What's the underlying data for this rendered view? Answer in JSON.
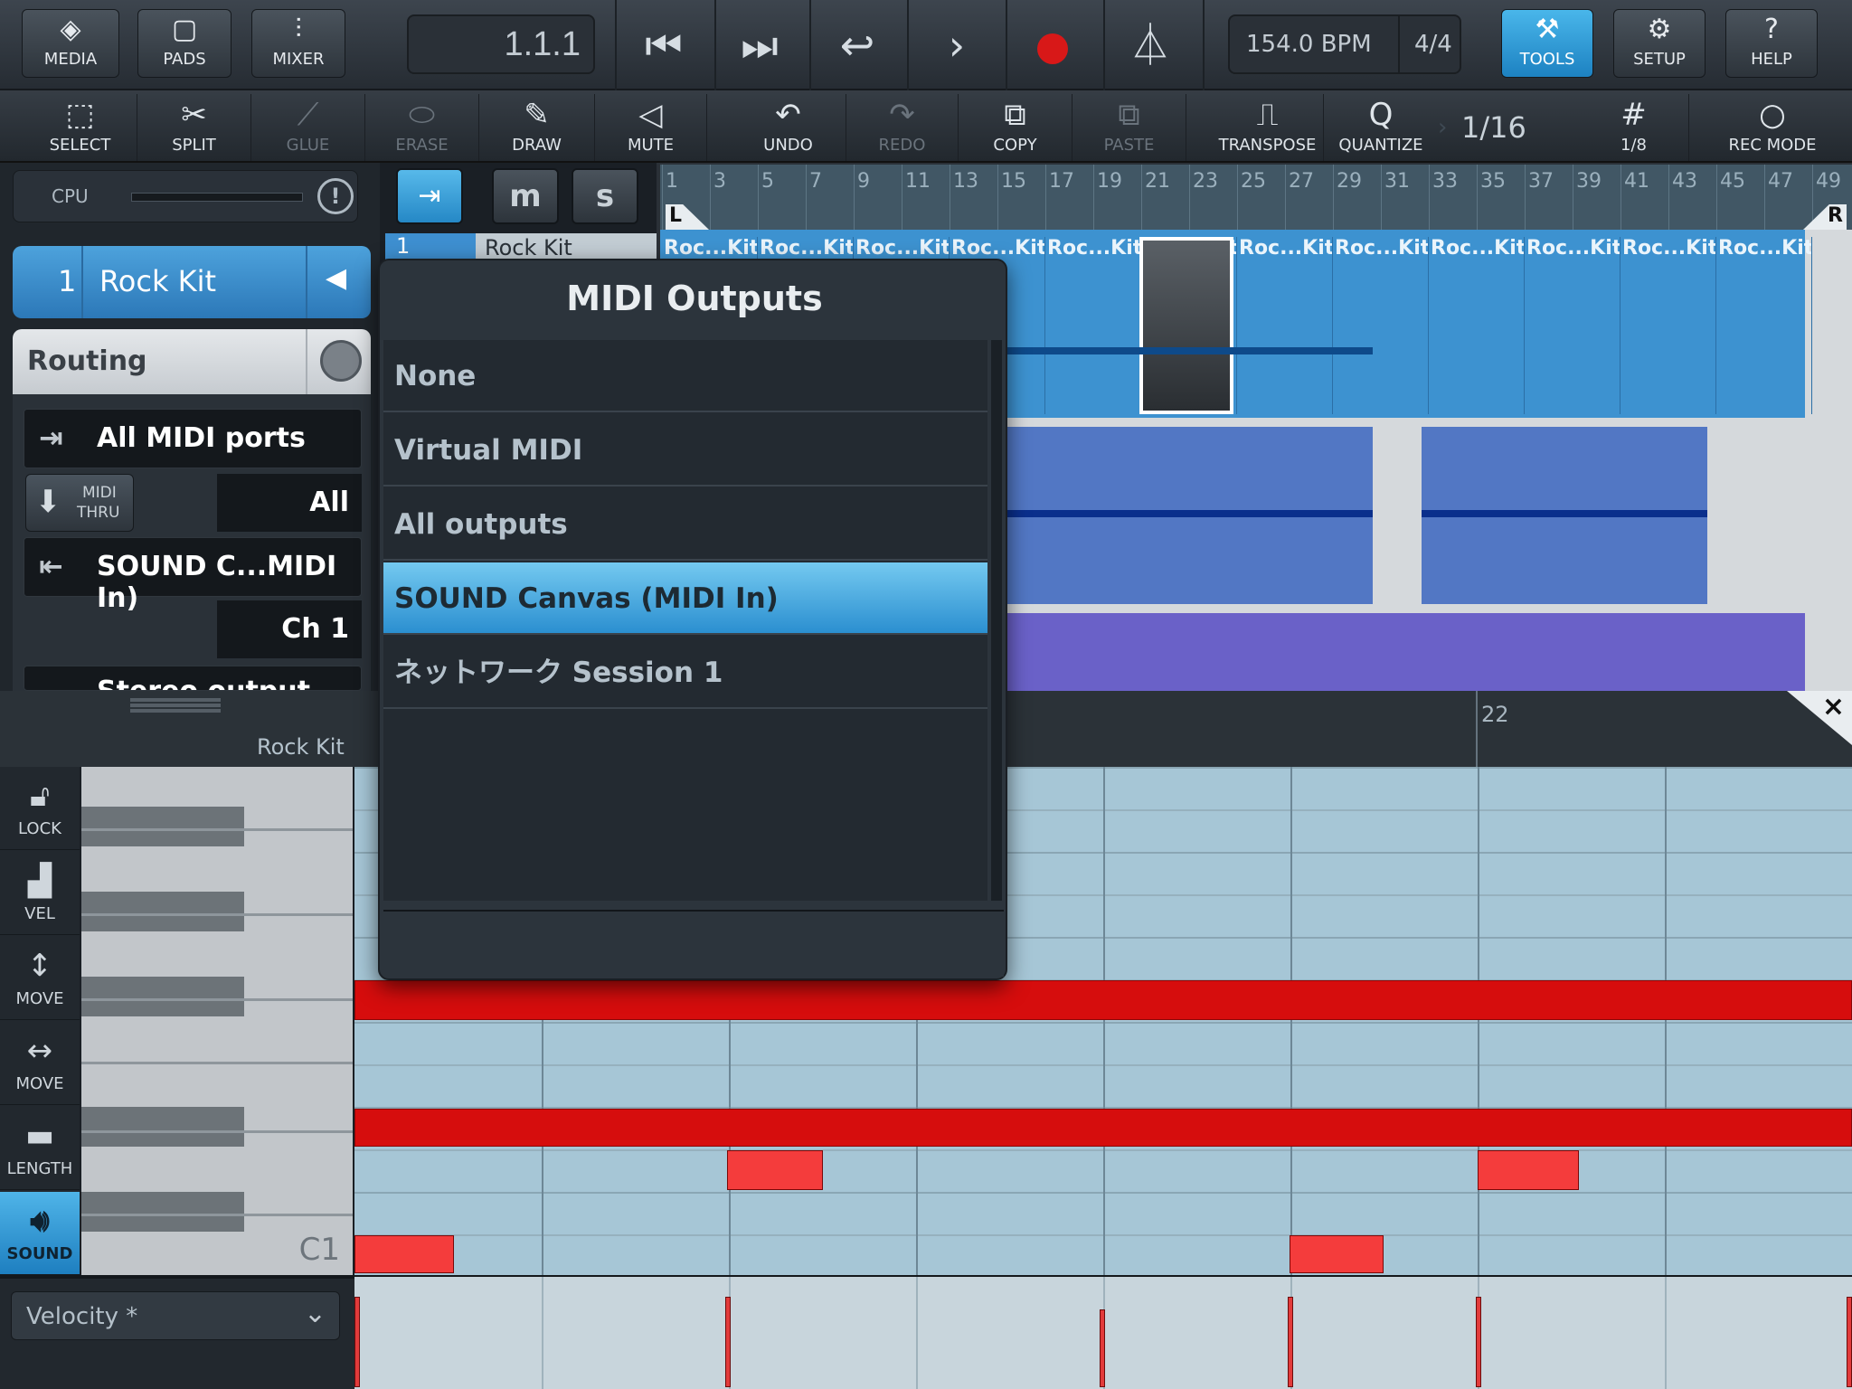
{
  "topbar": {
    "media_label": "MEDIA",
    "pads_label": "PADS",
    "mixer_label": "MIXER",
    "position": "1.1.1",
    "tempo": "154.0 BPM",
    "time_signature": "4/4",
    "tools_label": "TOOLS",
    "setup_label": "SETUP",
    "help_label": "HELP"
  },
  "toolbar": {
    "select": "SELECT",
    "split": "SPLIT",
    "glue": "GLUE",
    "erase": "ERASE",
    "draw": "DRAW",
    "mute": "MUTE",
    "undo": "UNDO",
    "redo": "REDO",
    "copy": "COPY",
    "paste": "PASTE",
    "transpose": "TRANSPOSE",
    "quantize": "QUANTIZE",
    "quantize_value": "1/16",
    "grid_value": "1/8",
    "rec_mode": "REC MODE"
  },
  "left": {
    "cpu_label": "CPU",
    "track_number": "1",
    "track_name": "Rock Kit",
    "routing_label": "Routing",
    "midi_in": "All MIDI ports",
    "midi_in_channel": "All",
    "midi_thru_line1": "MIDI",
    "midi_thru_line2": "THRU",
    "midi_out": "SOUND C...MIDI In)",
    "midi_out_channel": "Ch 1",
    "audio_out_partial": "Stereo output"
  },
  "arranger": {
    "mute_label": "m",
    "solo_label": "s",
    "ruler_marks": [
      "1",
      "3",
      "5",
      "7",
      "9",
      "11",
      "13",
      "15",
      "17",
      "19",
      "21",
      "23",
      "25",
      "27",
      "29",
      "31",
      "33",
      "35",
      "37",
      "39",
      "41",
      "43",
      "45",
      "47",
      "49"
    ],
    "locator_left": "L",
    "locator_right": "R",
    "track_row_number": "1",
    "track_row_name": "Rock Kit",
    "clip_labels": [
      "Roc...Kit",
      "Roc...Kit",
      "Roc...Kit",
      "Roc...Kit",
      "Roc...Kit",
      "Roc...Kit",
      "Roc...Kit",
      "Roc...Kit",
      "Roc...Kit",
      "Roc...Kit",
      "Roc...Kit",
      "Roc...Kit"
    ]
  },
  "popup": {
    "title": "MIDI Outputs",
    "items": [
      "None",
      "Virtual MIDI",
      "All outputs",
      "SOUND Canvas (MIDI In)",
      "ネットワーク Session 1"
    ],
    "selected_index": 3
  },
  "piano_roll": {
    "track_name": "Rock Kit",
    "bar_marker": "22",
    "close_icon": "×",
    "note_label_c1": "C1",
    "tools": [
      "LOCK",
      "VEL",
      "MOVE",
      "MOVE",
      "LENGTH",
      "SOUND"
    ],
    "velocity_dropdown": "Velocity *"
  },
  "colors": {
    "accent_blue": "#2b8fd0",
    "note_red": "#d60d0d",
    "clip_blue": "#3d92d0"
  }
}
